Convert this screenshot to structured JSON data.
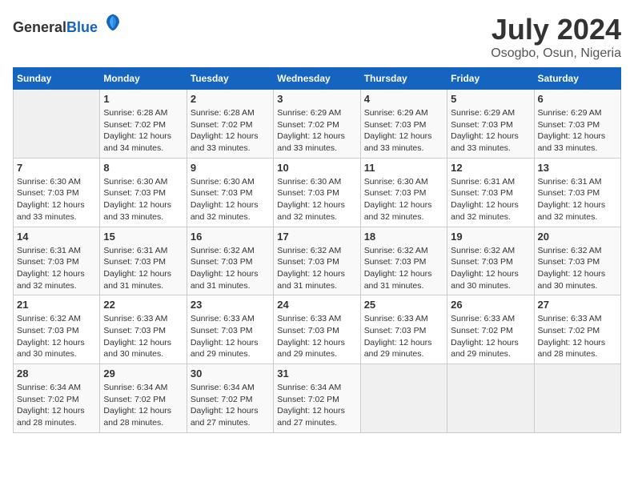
{
  "header": {
    "logo_general": "General",
    "logo_blue": "Blue",
    "title": "July 2024",
    "subtitle": "Osogbo, Osun, Nigeria"
  },
  "calendar": {
    "days_of_week": [
      "Sunday",
      "Monday",
      "Tuesday",
      "Wednesday",
      "Thursday",
      "Friday",
      "Saturday"
    ],
    "weeks": [
      [
        {
          "day": "",
          "detail": ""
        },
        {
          "day": "1",
          "detail": "Sunrise: 6:28 AM\nSunset: 7:02 PM\nDaylight: 12 hours\nand 34 minutes."
        },
        {
          "day": "2",
          "detail": "Sunrise: 6:28 AM\nSunset: 7:02 PM\nDaylight: 12 hours\nand 33 minutes."
        },
        {
          "day": "3",
          "detail": "Sunrise: 6:29 AM\nSunset: 7:02 PM\nDaylight: 12 hours\nand 33 minutes."
        },
        {
          "day": "4",
          "detail": "Sunrise: 6:29 AM\nSunset: 7:03 PM\nDaylight: 12 hours\nand 33 minutes."
        },
        {
          "day": "5",
          "detail": "Sunrise: 6:29 AM\nSunset: 7:03 PM\nDaylight: 12 hours\nand 33 minutes."
        },
        {
          "day": "6",
          "detail": "Sunrise: 6:29 AM\nSunset: 7:03 PM\nDaylight: 12 hours\nand 33 minutes."
        }
      ],
      [
        {
          "day": "7",
          "detail": "Sunrise: 6:30 AM\nSunset: 7:03 PM\nDaylight: 12 hours\nand 33 minutes."
        },
        {
          "day": "8",
          "detail": "Sunrise: 6:30 AM\nSunset: 7:03 PM\nDaylight: 12 hours\nand 33 minutes."
        },
        {
          "day": "9",
          "detail": "Sunrise: 6:30 AM\nSunset: 7:03 PM\nDaylight: 12 hours\nand 32 minutes."
        },
        {
          "day": "10",
          "detail": "Sunrise: 6:30 AM\nSunset: 7:03 PM\nDaylight: 12 hours\nand 32 minutes."
        },
        {
          "day": "11",
          "detail": "Sunrise: 6:30 AM\nSunset: 7:03 PM\nDaylight: 12 hours\nand 32 minutes."
        },
        {
          "day": "12",
          "detail": "Sunrise: 6:31 AM\nSunset: 7:03 PM\nDaylight: 12 hours\nand 32 minutes."
        },
        {
          "day": "13",
          "detail": "Sunrise: 6:31 AM\nSunset: 7:03 PM\nDaylight: 12 hours\nand 32 minutes."
        }
      ],
      [
        {
          "day": "14",
          "detail": "Sunrise: 6:31 AM\nSunset: 7:03 PM\nDaylight: 12 hours\nand 32 minutes."
        },
        {
          "day": "15",
          "detail": "Sunrise: 6:31 AM\nSunset: 7:03 PM\nDaylight: 12 hours\nand 31 minutes."
        },
        {
          "day": "16",
          "detail": "Sunrise: 6:32 AM\nSunset: 7:03 PM\nDaylight: 12 hours\nand 31 minutes."
        },
        {
          "day": "17",
          "detail": "Sunrise: 6:32 AM\nSunset: 7:03 PM\nDaylight: 12 hours\nand 31 minutes."
        },
        {
          "day": "18",
          "detail": "Sunrise: 6:32 AM\nSunset: 7:03 PM\nDaylight: 12 hours\nand 31 minutes."
        },
        {
          "day": "19",
          "detail": "Sunrise: 6:32 AM\nSunset: 7:03 PM\nDaylight: 12 hours\nand 30 minutes."
        },
        {
          "day": "20",
          "detail": "Sunrise: 6:32 AM\nSunset: 7:03 PM\nDaylight: 12 hours\nand 30 minutes."
        }
      ],
      [
        {
          "day": "21",
          "detail": "Sunrise: 6:32 AM\nSunset: 7:03 PM\nDaylight: 12 hours\nand 30 minutes."
        },
        {
          "day": "22",
          "detail": "Sunrise: 6:33 AM\nSunset: 7:03 PM\nDaylight: 12 hours\nand 30 minutes."
        },
        {
          "day": "23",
          "detail": "Sunrise: 6:33 AM\nSunset: 7:03 PM\nDaylight: 12 hours\nand 29 minutes."
        },
        {
          "day": "24",
          "detail": "Sunrise: 6:33 AM\nSunset: 7:03 PM\nDaylight: 12 hours\nand 29 minutes."
        },
        {
          "day": "25",
          "detail": "Sunrise: 6:33 AM\nSunset: 7:03 PM\nDaylight: 12 hours\nand 29 minutes."
        },
        {
          "day": "26",
          "detail": "Sunrise: 6:33 AM\nSunset: 7:02 PM\nDaylight: 12 hours\nand 29 minutes."
        },
        {
          "day": "27",
          "detail": "Sunrise: 6:33 AM\nSunset: 7:02 PM\nDaylight: 12 hours\nand 28 minutes."
        }
      ],
      [
        {
          "day": "28",
          "detail": "Sunrise: 6:34 AM\nSunset: 7:02 PM\nDaylight: 12 hours\nand 28 minutes."
        },
        {
          "day": "29",
          "detail": "Sunrise: 6:34 AM\nSunset: 7:02 PM\nDaylight: 12 hours\nand 28 minutes."
        },
        {
          "day": "30",
          "detail": "Sunrise: 6:34 AM\nSunset: 7:02 PM\nDaylight: 12 hours\nand 27 minutes."
        },
        {
          "day": "31",
          "detail": "Sunrise: 6:34 AM\nSunset: 7:02 PM\nDaylight: 12 hours\nand 27 minutes."
        },
        {
          "day": "",
          "detail": ""
        },
        {
          "day": "",
          "detail": ""
        },
        {
          "day": "",
          "detail": ""
        }
      ]
    ]
  }
}
